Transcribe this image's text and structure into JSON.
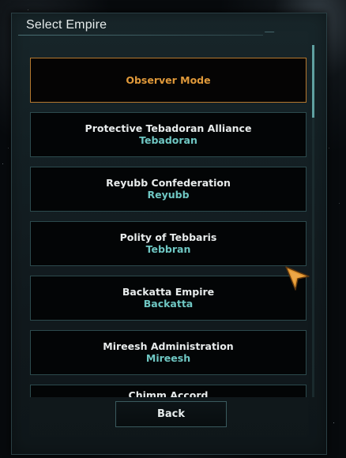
{
  "dialog": {
    "title": "Select Empire"
  },
  "empires": [
    {
      "name": "Observer Mode",
      "species": "",
      "kind": "observer"
    },
    {
      "name": "Protective Tebadoran Alliance",
      "species": "Tebadoran",
      "kind": "empire"
    },
    {
      "name": "Reyubb Confederation",
      "species": "Reyubb",
      "kind": "empire"
    },
    {
      "name": "Polity of Tebbaris",
      "species": "Tebbran",
      "kind": "empire"
    },
    {
      "name": "Backatta Empire",
      "species": "Backatta",
      "kind": "empire"
    },
    {
      "name": "Mireesh Administration",
      "species": "Mireesh",
      "kind": "empire"
    },
    {
      "name": "Chimm Accord",
      "species": "",
      "kind": "empire"
    }
  ],
  "footer": {
    "back_label": "Back"
  },
  "colors": {
    "accent_orange": "#e0993a",
    "species_teal": "#6fc7c3",
    "border_teal": "#2c4a4d"
  },
  "icons": {
    "cursor": "arrow-cursor-icon"
  }
}
